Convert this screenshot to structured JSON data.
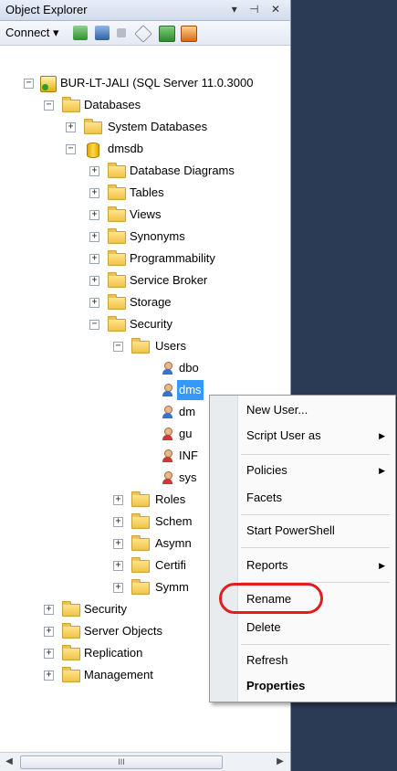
{
  "panel": {
    "title": "Object Explorer",
    "title_icons": "▾ ⊣ ✕",
    "toolbar": {
      "connect_label": "Connect ▾",
      "buttons": [
        "connect-icon",
        "disconnect-icon",
        "stop-icon",
        "filter-icon",
        "refresh-icon",
        "activity-icon"
      ]
    }
  },
  "tree": {
    "server": "BUR-LT-JALI (SQL Server 11.0.3000",
    "databases": "Databases",
    "system_databases": "System Databases",
    "dmsdb": "dmsdb",
    "database_diagrams": "Database Diagrams",
    "tables": "Tables",
    "views": "Views",
    "synonyms": "Synonyms",
    "programmability": "Programmability",
    "service_broker": "Service Broker",
    "storage": "Storage",
    "security": "Security",
    "users": "Users",
    "user_dbo": "dbo",
    "user_dms": "dms",
    "user_dm2": "dm",
    "user_guest": "gu",
    "user_info": "INF",
    "user_sys": "sys",
    "roles": "Roles",
    "schemas": "Schem",
    "asymmetric": "Asymn",
    "certificates": "Certifi",
    "symmetric": "Symm",
    "top_security": "Security",
    "server_objects": "Server Objects",
    "replication": "Replication",
    "management": "Management",
    "expand_plus": "+",
    "expand_minus": "−"
  },
  "scrollbar": {
    "left_arrow": "◀",
    "right_arrow": "▶",
    "thumb_grip": "III"
  },
  "context_menu": {
    "new_user": "New User...",
    "script_user_as": "Script User as",
    "policies": "Policies",
    "facets": "Facets",
    "start_powershell": "Start PowerShell",
    "reports": "Reports",
    "rename": "Rename",
    "delete": "Delete",
    "refresh": "Refresh",
    "properties": "Properties",
    "submenu_arrow": "▶"
  }
}
